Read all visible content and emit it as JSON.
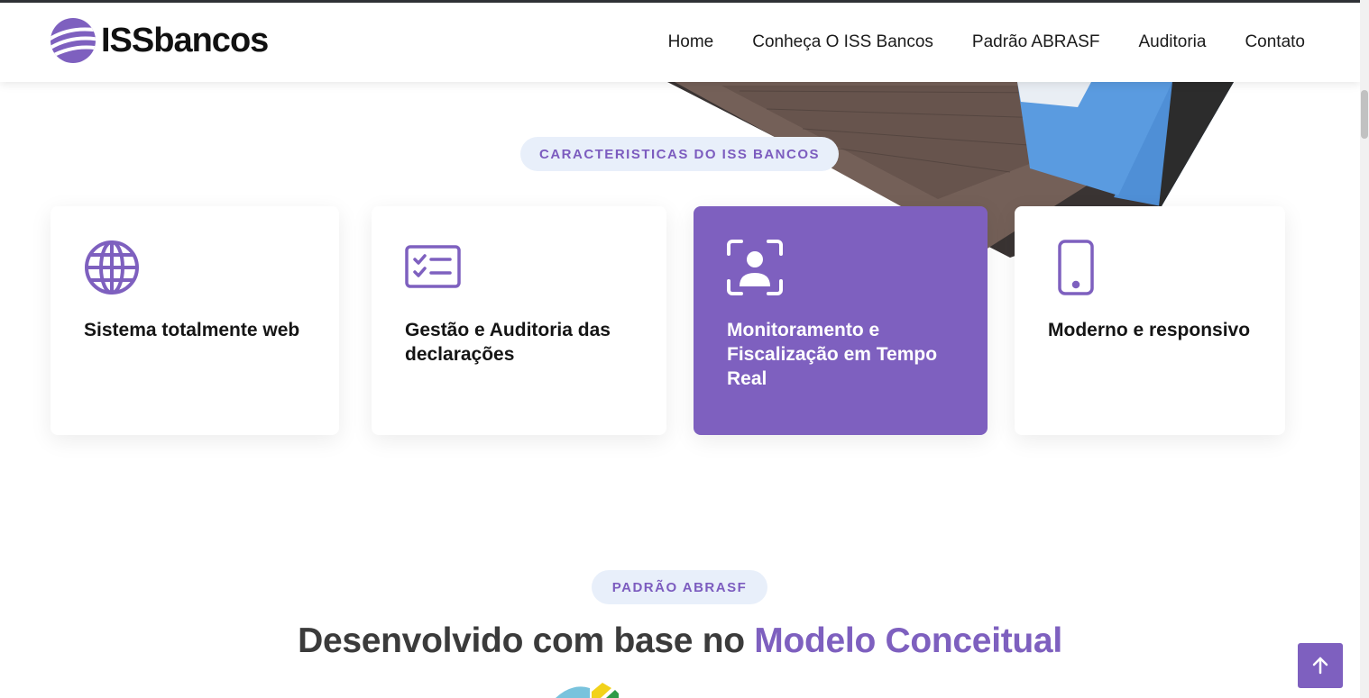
{
  "brand": {
    "name": "ISSbancos",
    "accent_color": "#7e60bf",
    "pill_bg": "#e8effa"
  },
  "nav": {
    "items": [
      {
        "label": "Home"
      },
      {
        "label": "Conheça O ISS Bancos"
      },
      {
        "label": "Padrão ABRASF"
      },
      {
        "label": "Auditoria"
      },
      {
        "label": "Contato"
      }
    ]
  },
  "features": {
    "badge": "CARACTERISTICAS DO ISS BANCOS",
    "cards": [
      {
        "icon": "globe-icon",
        "title": "Sistema totalmente web",
        "active": false
      },
      {
        "icon": "checklist-icon",
        "title": "Gestão e Auditoria das declarações",
        "active": false
      },
      {
        "icon": "user-scan-icon",
        "title": "Monitoramento e Fiscalização em Tempo Real",
        "active": true
      },
      {
        "icon": "smartphone-icon",
        "title": "Moderno e responsivo",
        "active": false
      }
    ]
  },
  "abrasf": {
    "badge": "PADRÃO ABRASF",
    "headline_prefix": "Desenvolvido com base no ",
    "headline_accent": "Modelo Conceitual"
  },
  "scroll_top": {
    "icon": "arrow-up-icon"
  }
}
